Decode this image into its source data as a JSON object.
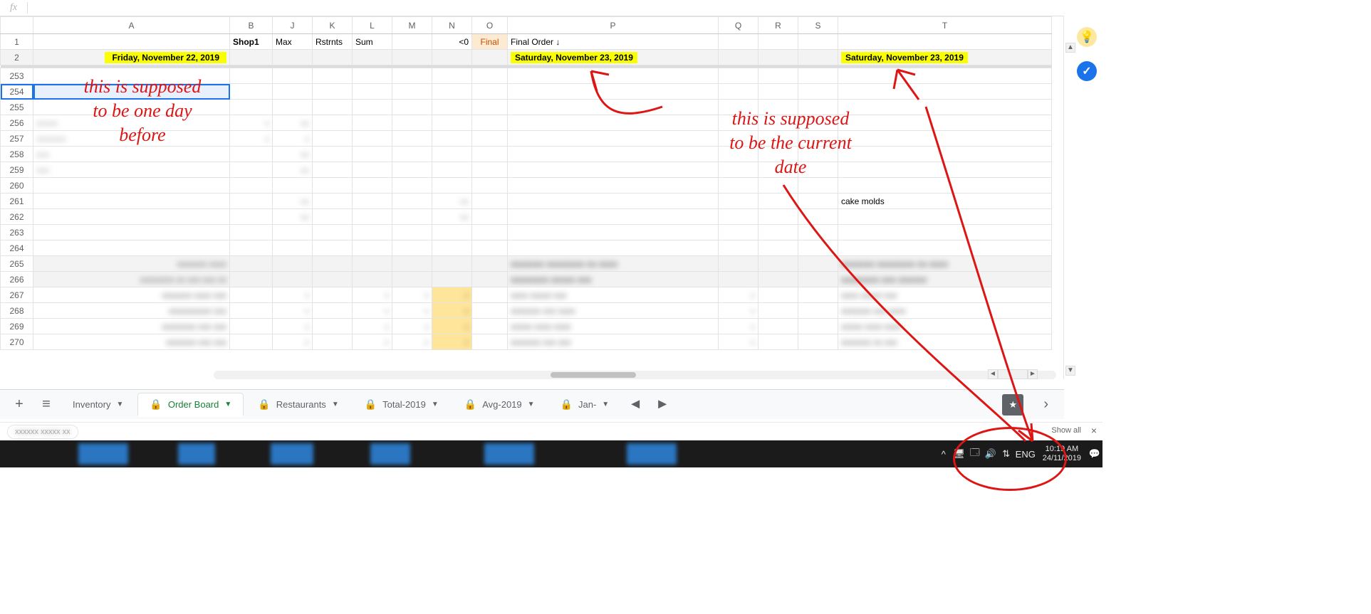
{
  "fx": {
    "label": "fx"
  },
  "columns": [
    "",
    "A",
    "B",
    "J",
    "K",
    "L",
    "M",
    "N",
    "O",
    "P",
    "Q",
    "R",
    "S",
    "T"
  ],
  "row_numbers": [
    "1",
    "2",
    "253",
    "254",
    "255",
    "256",
    "257",
    "258",
    "259",
    "260",
    "261",
    "262",
    "263",
    "264",
    "265",
    "266",
    "267",
    "268",
    "269",
    "270"
  ],
  "row1": {
    "B": "Shop1",
    "J": "Max",
    "K": "Rstrnts",
    "L": "Sum",
    "N": "<0",
    "O": "Final",
    "P": "Final Order ↓"
  },
  "row2": {
    "A": "Friday, November 22, 2019",
    "P": "Saturday, November 23, 2019",
    "T": "Saturday, November 23, 2019"
  },
  "cells": {
    "T261": "cake molds"
  },
  "annotations": {
    "left": "this is supposed\nto be one day\nbefore",
    "right": "this is supposed\nto be the current\ndate"
  },
  "sheetTabs": {
    "add_title": "+",
    "all_title": "≡",
    "items": [
      {
        "label": "Inventory",
        "locked": false,
        "active": false
      },
      {
        "label": "Order Board",
        "locked": true,
        "active": true
      },
      {
        "label": "Restaurants",
        "locked": true,
        "active": false
      },
      {
        "label": "Total-2019",
        "locked": true,
        "active": false
      },
      {
        "label": "Avg-2019",
        "locked": true,
        "active": false
      },
      {
        "label": "Jan-",
        "locked": true,
        "active": false
      }
    ],
    "explore_star": "★"
  },
  "downloads": {
    "showall": "Show all",
    "close": "×"
  },
  "tray": {
    "lang": "ENG",
    "time": "10:19 AM",
    "date": "24/11/2019"
  }
}
